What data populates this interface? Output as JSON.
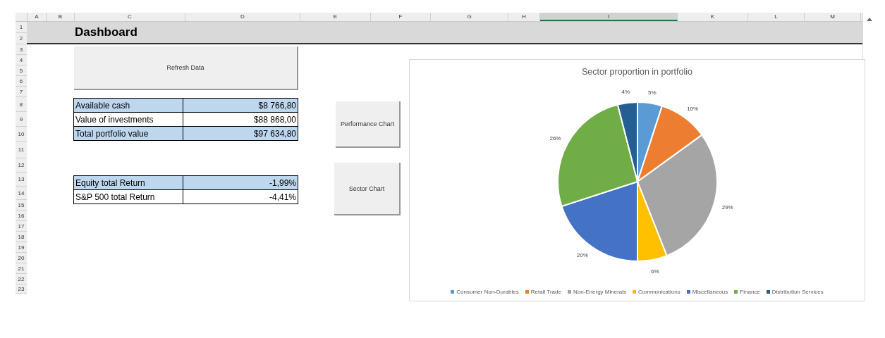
{
  "columns": [
    {
      "label": "A",
      "selected": false
    },
    {
      "label": "B",
      "selected": false
    },
    {
      "label": "C",
      "selected": false
    },
    {
      "label": "D",
      "selected": false
    },
    {
      "label": "E",
      "selected": false
    },
    {
      "label": "F",
      "selected": false
    },
    {
      "label": "G",
      "selected": false
    },
    {
      "label": "H",
      "selected": false
    },
    {
      "label": "I",
      "selected": true
    },
    {
      "label": "K",
      "selected": false
    },
    {
      "label": "L",
      "selected": false
    },
    {
      "label": "M",
      "selected": false
    }
  ],
  "rows": [
    "1",
    "2",
    "3",
    "4",
    "5",
    "6",
    "7",
    "8",
    "9",
    "10",
    "11",
    "12",
    "13",
    "14",
    "15",
    "16",
    "17",
    "18",
    "19",
    "20",
    "21",
    "22",
    "23"
  ],
  "title": "Dashboard",
  "refresh_button": "Refresh Data",
  "summary_table": [
    {
      "label": "Available cash",
      "value": "$8 766,80",
      "highlighted": true
    },
    {
      "label": "Value of investments",
      "value": "$88 868,00",
      "highlighted": false
    },
    {
      "label": "Total portfolio value",
      "value": "$97 634,80",
      "highlighted": true
    }
  ],
  "return_table": [
    {
      "label": "Equity total Return",
      "value": "-1,99%",
      "highlighted": true
    },
    {
      "label": "S&P 500 total Return",
      "value": "-4,41%",
      "highlighted": false
    }
  ],
  "buttons": [
    "Performance Chart",
    "Sector Chart"
  ],
  "chart_data": {
    "type": "pie",
    "title": "Sector proportion in portfolio",
    "categories": [
      "Consumer Non-Durables",
      "Retail Trade",
      "Non-Energy Minerals",
      "Communications",
      "Miscellaneous",
      "Finance",
      "Distribution Services"
    ],
    "series": [
      {
        "colors": [
          "#5b9bd5",
          "#ed7d31",
          "#a5a5a5",
          "#ffc000",
          "#4472c4",
          "#70ad47",
          "#255e91"
        ],
        "values": [
          5,
          10,
          29,
          6,
          20,
          26,
          4
        ]
      }
    ],
    "value_labels": [
      "5%",
      "10%",
      "29%",
      "6%",
      "20%",
      "26%",
      "4%"
    ]
  }
}
